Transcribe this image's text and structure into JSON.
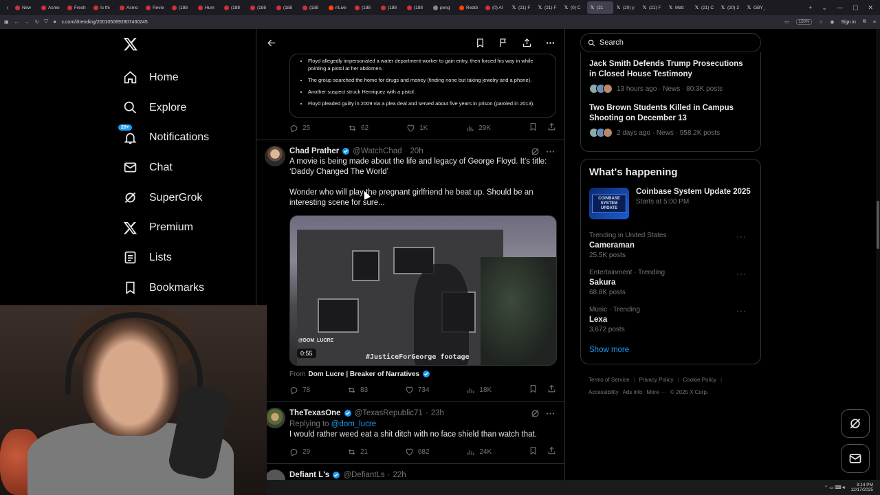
{
  "browser": {
    "tabs": [
      {
        "label": "New",
        "icon": "youtube"
      },
      {
        "label": "Asmo",
        "icon": "youtube"
      },
      {
        "label": "Fresh",
        "icon": "youtube"
      },
      {
        "label": "Is thi",
        "icon": "youtube"
      },
      {
        "label": "Asmo",
        "icon": "youtube"
      },
      {
        "label": "Revie",
        "icon": "youtube"
      },
      {
        "label": "(188",
        "icon": "youtube"
      },
      {
        "label": "Hum",
        "icon": "youtube"
      },
      {
        "label": "(188",
        "icon": "youtube"
      },
      {
        "label": "(188",
        "icon": "youtube"
      },
      {
        "label": "(188",
        "icon": "youtube"
      },
      {
        "label": "(188",
        "icon": "youtube"
      },
      {
        "label": "r/Live",
        "icon": "reddit"
      },
      {
        "label": "(188",
        "icon": "youtube"
      },
      {
        "label": "(188",
        "icon": "youtube"
      },
      {
        "label": "(188",
        "icon": "youtube"
      },
      {
        "label": "peng",
        "icon": "globe"
      },
      {
        "label": "Reddi",
        "icon": "reddit"
      },
      {
        "label": "(0) Al",
        "icon": "youtube"
      },
      {
        "label": "(21) F",
        "icon": "x"
      },
      {
        "label": "(21) F",
        "icon": "x"
      },
      {
        "label": "(0) C",
        "icon": "x"
      },
      {
        "label": "(21",
        "icon": "x",
        "active": true
      },
      {
        "label": "(20) y",
        "icon": "x"
      },
      {
        "label": "(21) F",
        "icon": "x"
      },
      {
        "label": "Matt",
        "icon": "x"
      },
      {
        "label": "(21) C",
        "icon": "x"
      },
      {
        "label": "(20) 2",
        "icon": "x"
      },
      {
        "label": "GBY_",
        "icon": "x"
      }
    ],
    "url": "x.com/i/trending/2001050692807430245",
    "zoom": "150%",
    "signin": "Sign in"
  },
  "nav": {
    "items": [
      {
        "label": "Home",
        "icon": "home-icon"
      },
      {
        "label": "Explore",
        "icon": "search-icon"
      },
      {
        "label": "Notifications",
        "icon": "bell-icon",
        "badge": "20+"
      },
      {
        "label": "Chat",
        "icon": "mail-icon"
      },
      {
        "label": "SuperGrok",
        "icon": "grok-icon"
      },
      {
        "label": "Premium",
        "icon": "x-logo-icon"
      },
      {
        "label": "Lists",
        "icon": "list-icon"
      },
      {
        "label": "Bookmarks",
        "icon": "bookmark-icon"
      }
    ]
  },
  "thread": {
    "card_bullets": [
      "Floyd allegedly impersonated a water department worker to gain entry, then forced his way in while pointing a pistol at her abdomen.",
      "The group searched the home for drugs and money (finding none but taking jewelry and a phone).",
      "Another suspect struck Henriquez with a pistol.",
      "Floyd pleaded guilty in 2009 via a plea deal and served about five years in prison (paroled in 2013)."
    ],
    "card_stats": {
      "replies": "25",
      "reposts": "62",
      "likes": "1K",
      "views": "29K"
    },
    "tweets": [
      {
        "name": "Chad Prather",
        "handle": "@WatchChad",
        "time": "20h",
        "text1": "A movie is being made about the life and legacy of George Floyd. It's title: ‘Daddy Changed The World’",
        "text2": "Wonder who will play the pregnant girlfriend he beat up. Should be an interesting scene for sure...",
        "video_duration": "0:55",
        "video_caption": "#JusticeForGeorge footage",
        "video_watermark": "@DOM_LUCRE",
        "from_label": "From",
        "from_name": "Dom Lucre | Breaker of Narratives",
        "stats": {
          "replies": "78",
          "reposts": "83",
          "likes": "734",
          "views": "18K"
        }
      },
      {
        "name": "TheTexasOne",
        "handle": "@TexasRepublic71",
        "time": "23h",
        "replying_label": "Replying to",
        "replying_to": "@dom_lucre",
        "text1": "I would rather weed eat a shit ditch with no face shield than watch that.",
        "stats": {
          "replies": "29",
          "reposts": "21",
          "likes": "682",
          "views": "24K"
        }
      },
      {
        "name": "Defiant L's",
        "handle": "@DefiantLs",
        "time": "22h"
      }
    ]
  },
  "right": {
    "search_placeholder": "Search",
    "news": [
      {
        "title": "Jack Smith Defends Trump Prosecutions in Closed House Testimony",
        "meta": "13 hours ago · News · 80.3K posts"
      },
      {
        "title": "Two Brown Students Killed in Campus Shooting on December 13",
        "meta": "2 days ago · News · 958.2K posts"
      }
    ],
    "whats_happening": "What's happening",
    "event": {
      "title": "Coinbase System Update 2025",
      "sub": "Starts at 5:00 PM",
      "img_label": "COINBASE SYSTEM UPDATE"
    },
    "trends": [
      {
        "context": "Trending in United States",
        "name": "Cameraman",
        "posts": "25.5K posts"
      },
      {
        "context": "Entertainment · Trending",
        "name": "Sakura",
        "posts": "68.8K posts"
      },
      {
        "context": "Music · Trending",
        "name": "Lexa",
        "posts": "3,672 posts"
      }
    ],
    "show_more": "Show more",
    "footer": [
      "Terms of Service",
      "Privacy Policy",
      "Cookie Policy",
      "Accessibility",
      "Ads info",
      "More ···",
      "© 2025 X Corp."
    ]
  },
  "taskbar": {
    "time": "3:14 PM",
    "date": "12/17/2025"
  },
  "colors": {
    "accent": "#1d9bf0",
    "bg": "#000000",
    "muted": "#71767b",
    "border": "#2f3336"
  }
}
